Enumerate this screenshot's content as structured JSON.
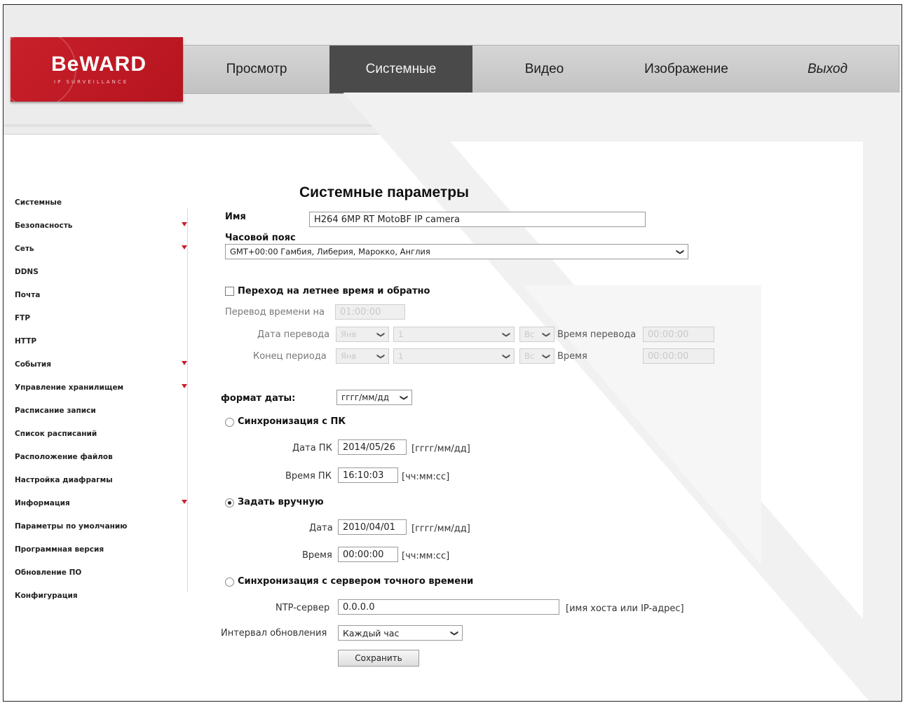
{
  "brand": {
    "logo_text": "BeWARD",
    "logo_subtitle": "IP SURVEILLANCE"
  },
  "nav": {
    "tabs": [
      {
        "label": "Просмотр",
        "active": false
      },
      {
        "label": "Системные",
        "active": true
      },
      {
        "label": "Видео",
        "active": false
      },
      {
        "label": "Изображение",
        "active": false
      },
      {
        "label": "Выход",
        "active": false
      }
    ]
  },
  "sidebar": {
    "items": [
      {
        "label": "Системные",
        "expandable": false
      },
      {
        "label": "Безопасность",
        "expandable": true
      },
      {
        "label": "Сеть",
        "expandable": true
      },
      {
        "label": "DDNS",
        "expandable": false
      },
      {
        "label": "Почта",
        "expandable": false
      },
      {
        "label": "FTP",
        "expandable": false
      },
      {
        "label": "HTTP",
        "expandable": false
      },
      {
        "label": "События",
        "expandable": true
      },
      {
        "label": "Управление хранилищем",
        "expandable": true
      },
      {
        "label": "Расписание записи",
        "expandable": false
      },
      {
        "label": "Список расписаний",
        "expandable": false
      },
      {
        "label": "Расположение файлов",
        "expandable": false
      },
      {
        "label": "Настройка диафрагмы",
        "expandable": false
      },
      {
        "label": "Информация",
        "expandable": true
      },
      {
        "label": "Параметры по умолчанию",
        "expandable": false
      },
      {
        "label": "Программная версия",
        "expandable": false
      },
      {
        "label": "Обновление ПО",
        "expandable": false
      },
      {
        "label": "Конфигурация",
        "expandable": false
      }
    ]
  },
  "main": {
    "title": "Системные параметры",
    "name_label": "Имя",
    "name_value": "H264 6MP RT MotoBF IP camera",
    "tz_label": "Часовой пояс",
    "tz_value": "GMT+00:00 Гамбия, Либерия, Марокко, Англия",
    "dst": {
      "checkbox_label": "Переход на летнее время и обратно",
      "checked": false,
      "offset_label": "Перевод времени на",
      "offset_value": "01:00:00",
      "start_label": "Дата перевода",
      "start_month": "Янв",
      "start_week": "1",
      "start_day": "Вс",
      "start_time_label": "Время перевода",
      "start_time": "00:00:00",
      "end_label": "Конец периода",
      "end_month": "Янв",
      "end_week": "1",
      "end_day": "Вс",
      "end_time_label": "Время",
      "end_time": "00:00:00"
    },
    "date_format_label": "формат даты:",
    "date_format_value": "гггг/мм/дд",
    "sync_pc": {
      "label": "Синхронизация с ПК",
      "selected": false,
      "date_label": "Дата ПК",
      "date_value": "2014/05/26",
      "date_hint": "[гггг/мм/дд]",
      "time_label": "Время ПК",
      "time_value": "16:10:03",
      "time_hint": "[чч:мм:сс]"
    },
    "manual": {
      "label": "Задать вручную",
      "selected": true,
      "date_label": "Дата",
      "date_value": "2010/04/01",
      "date_hint": "[гггг/мм/дд]",
      "time_label": "Время",
      "time_value": "00:00:00",
      "time_hint": "[чч:мм:сс]"
    },
    "ntp": {
      "label": "Синхронизация с сервером точного времени",
      "selected": false,
      "server_label": "NTP-сервер",
      "server_value": "0.0.0.0",
      "server_hint": "[имя хоста или IP-адрес]",
      "interval_label": "Интервал обновления",
      "interval_value": "Каждый час"
    },
    "save_label": "Сохранить"
  },
  "colors": {
    "brand_red": "#c9202b",
    "active_tab": "#4a4a4a",
    "arrow_red": "#c8202c"
  }
}
